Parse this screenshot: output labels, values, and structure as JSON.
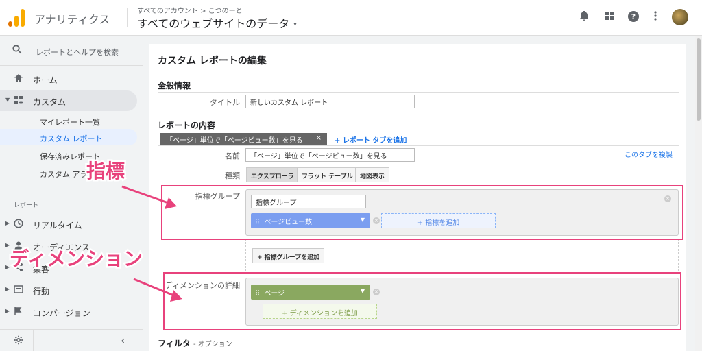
{
  "header": {
    "app_title": "アナリティクス",
    "breadcrumb": "すべてのアカウント > こつのーと",
    "view_name": "すべてのウェブサイトのデータ",
    "view_caret": "▾",
    "icons": [
      "bell-icon",
      "apps-icon",
      "help-icon",
      "more-vert-icon"
    ],
    "brand_color": "#f9ab00"
  },
  "sidebar": {
    "search_placeholder": "レポートとヘルプを検索",
    "home": "ホーム",
    "custom": "カスタム",
    "custom_items": [
      "マイレポート一覧",
      "カスタム レポート",
      "保存済みレポート",
      "カスタム アラート"
    ],
    "section_label": "レポート",
    "report_items": [
      "リアルタイム",
      "オーディエンス",
      "集客",
      "行動",
      "コンバージョン"
    ]
  },
  "main": {
    "title": "カスタム レポートの編集",
    "general_section": "全般情報",
    "title_label": "タイトル",
    "title_value": "新しいカスタム レポート",
    "content_section": "レポートの内容",
    "tab_label": "「ページ」単位で「ページビュー数」を見る",
    "tab_close": "×",
    "add_tab": "+ レポート タブを追加",
    "duplicate_tab": "このタブを複製",
    "name_label": "名前",
    "name_value": "「ページ」単位で「ページビュー数」を見る",
    "type_label": "種類",
    "types": [
      "エクスプローラ",
      "フラット テーブル",
      "地図表示"
    ],
    "metric_group_label": "指標グループ",
    "metric_group_value": "指標グループ",
    "metric_chip": "ページビュー数",
    "add_metric": "+ 指標を追加",
    "add_metric_group": "+ 指標グループを追加",
    "dimension_label": "ディメンションの詳細",
    "dimension_chip": "ページ",
    "add_dimension": "+ ディメンションを追加",
    "filter_label": "フィルタ",
    "filter_optional": "- オプション"
  },
  "annotations": {
    "metric_text": "指標",
    "dimension_text": "ディメンション",
    "color": "#e8427c"
  }
}
